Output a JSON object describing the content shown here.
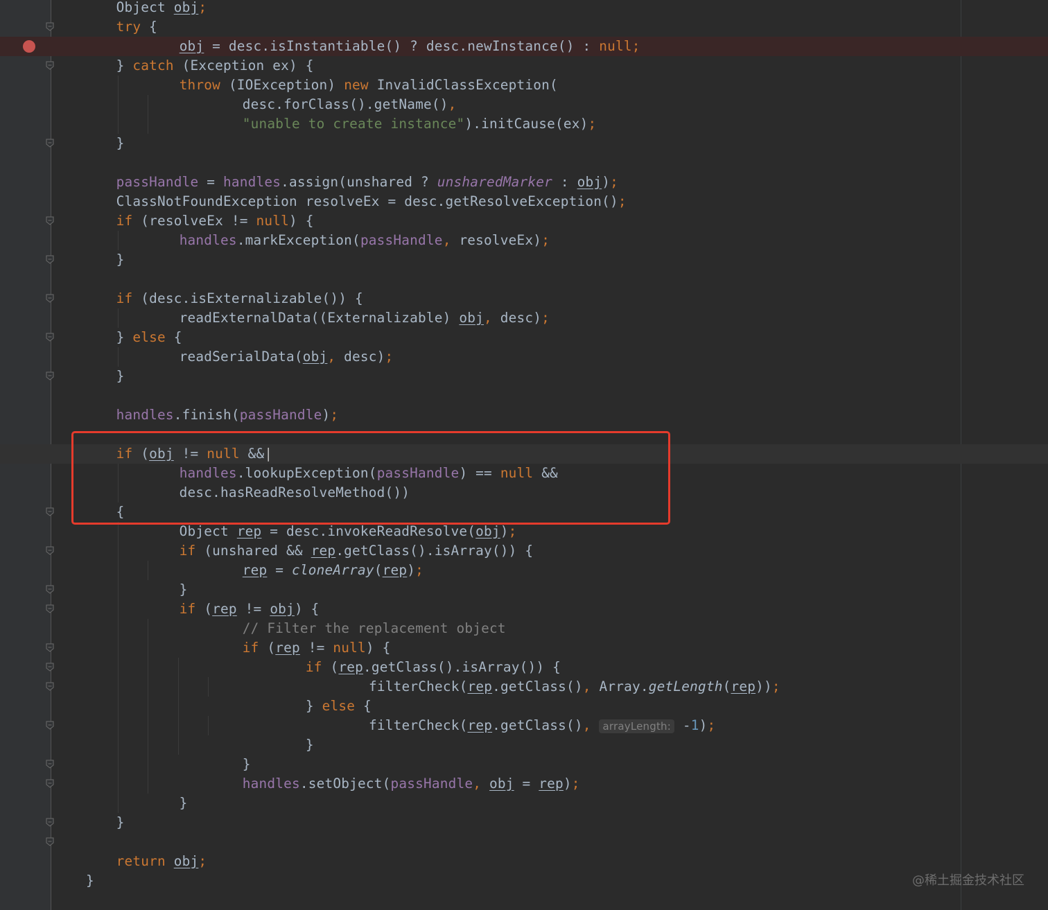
{
  "editor": {
    "breakpoint_line": 2,
    "caret_line": 23,
    "folds": [
      1,
      3,
      7,
      11,
      13,
      15,
      17,
      19,
      26,
      28,
      30,
      31,
      33,
      34,
      35,
      37,
      39,
      40,
      42,
      43,
      46
    ],
    "lines": [
      [
        [
          "Object ",
          ""
        ],
        [
          "obj",
          "v"
        ],
        [
          ";",
          "k"
        ]
      ],
      [
        [
          "try ",
          "k"
        ],
        [
          "{",
          ""
        ]
      ],
      [
        [
          "    ",
          ""
        ],
        [
          "obj",
          "v"
        ],
        [
          " = desc.isInstantiable() ? desc.newInstance() : ",
          ""
        ],
        [
          "null",
          "k"
        ],
        [
          ";",
          "k"
        ]
      ],
      [
        [
          "} ",
          ""
        ],
        [
          "catch ",
          "k"
        ],
        [
          "(Exception ex) {",
          ""
        ]
      ],
      [
        [
          "    ",
          ""
        ],
        [
          "throw ",
          "k"
        ],
        [
          "(IOException) ",
          ""
        ],
        [
          "new ",
          "k"
        ],
        [
          "InvalidClassException(",
          ""
        ]
      ],
      [
        [
          "        desc.forClass().getName()",
          ""
        ],
        [
          ",",
          "k"
        ]
      ],
      [
        [
          "        ",
          ""
        ],
        [
          "\"unable to create instance\"",
          "s"
        ],
        [
          ").initCause(ex)",
          ""
        ],
        [
          ";",
          "k"
        ]
      ],
      [
        [
          "}",
          ""
        ]
      ],
      [],
      [
        [
          "passHandle",
          "f"
        ],
        [
          " = ",
          ""
        ],
        [
          "handles",
          "f"
        ],
        [
          ".assign(unshared ? ",
          ""
        ],
        [
          "unsharedMarker",
          "sf"
        ],
        [
          " : ",
          ""
        ],
        [
          "obj",
          "v"
        ],
        [
          ")",
          ""
        ],
        [
          ";",
          "k"
        ]
      ],
      [
        [
          "ClassNotFoundException resolveEx = desc.getResolveException()",
          ""
        ],
        [
          ";",
          "k"
        ]
      ],
      [
        [
          "if ",
          "k"
        ],
        [
          "(resolveEx != ",
          ""
        ],
        [
          "null",
          "k"
        ],
        [
          ") {",
          ""
        ]
      ],
      [
        [
          "    ",
          ""
        ],
        [
          "handles",
          "f"
        ],
        [
          ".markException(",
          ""
        ],
        [
          "passHandle",
          "f"
        ],
        [
          ", ",
          "k"
        ],
        [
          "resolveEx)",
          ""
        ],
        [
          ";",
          "k"
        ]
      ],
      [
        [
          "}",
          ""
        ]
      ],
      [],
      [
        [
          "if ",
          "k"
        ],
        [
          "(desc.isExternalizable()) {",
          ""
        ]
      ],
      [
        [
          "    readExternalData((Externalizable) ",
          ""
        ],
        [
          "obj",
          "v"
        ],
        [
          ", ",
          "k"
        ],
        [
          "desc)",
          ""
        ],
        [
          ";",
          "k"
        ]
      ],
      [
        [
          "} ",
          ""
        ],
        [
          "else ",
          "k"
        ],
        [
          "{",
          ""
        ]
      ],
      [
        [
          "    readSerialData(",
          ""
        ],
        [
          "obj",
          "v"
        ],
        [
          ", ",
          "k"
        ],
        [
          "desc)",
          ""
        ],
        [
          ";",
          "k"
        ]
      ],
      [
        [
          "}",
          ""
        ]
      ],
      [],
      [
        [
          "handles",
          "f"
        ],
        [
          ".finish(",
          ""
        ],
        [
          "passHandle",
          "f"
        ],
        [
          ")",
          ""
        ],
        [
          ";",
          "k"
        ]
      ],
      [],
      [
        [
          "if ",
          "k"
        ],
        [
          "(",
          ""
        ],
        [
          "obj",
          "v"
        ],
        [
          " != ",
          ""
        ],
        [
          "null ",
          "k"
        ],
        [
          "&&",
          ""
        ],
        [
          "|",
          "c"
        ]
      ],
      [
        [
          "    ",
          ""
        ],
        [
          "handles",
          "f"
        ],
        [
          ".lookupException(",
          ""
        ],
        [
          "passHandle",
          "f"
        ],
        [
          ") == ",
          ""
        ],
        [
          "null ",
          "k"
        ],
        [
          "&&",
          ""
        ]
      ],
      [
        [
          "    desc.hasReadResolveMethod())",
          ""
        ]
      ],
      [
        [
          "{",
          ""
        ]
      ],
      [
        [
          "    Object ",
          ""
        ],
        [
          "rep",
          "v"
        ],
        [
          " = desc.invokeReadResolve(",
          ""
        ],
        [
          "obj",
          "v"
        ],
        [
          ")",
          ""
        ],
        [
          ";",
          "k"
        ]
      ],
      [
        [
          "    ",
          ""
        ],
        [
          "if ",
          "k"
        ],
        [
          "(unshared && ",
          ""
        ],
        [
          "rep",
          "v"
        ],
        [
          ".getClass().isArray()) {",
          ""
        ]
      ],
      [
        [
          "        ",
          ""
        ],
        [
          "rep",
          "v"
        ],
        [
          " = ",
          ""
        ],
        [
          "cloneArray",
          "mi"
        ],
        [
          "(",
          ""
        ],
        [
          "rep",
          "v"
        ],
        [
          ")",
          ""
        ],
        [
          ";",
          "k"
        ]
      ],
      [
        [
          "    }",
          ""
        ]
      ],
      [
        [
          "    ",
          ""
        ],
        [
          "if ",
          "k"
        ],
        [
          "(",
          ""
        ],
        [
          "rep",
          "v"
        ],
        [
          " != ",
          ""
        ],
        [
          "obj",
          "v"
        ],
        [
          ") {",
          ""
        ]
      ],
      [
        [
          "        ",
          ""
        ],
        [
          "// Filter the replacement object",
          "cm"
        ]
      ],
      [
        [
          "        ",
          ""
        ],
        [
          "if ",
          "k"
        ],
        [
          "(",
          ""
        ],
        [
          "rep",
          "v"
        ],
        [
          " != ",
          ""
        ],
        [
          "null",
          "k"
        ],
        [
          ") {",
          ""
        ]
      ],
      [
        [
          "            ",
          ""
        ],
        [
          "if ",
          "k"
        ],
        [
          "(",
          ""
        ],
        [
          "rep",
          "v"
        ],
        [
          ".getClass().isArray()) {",
          ""
        ]
      ],
      [
        [
          "                filterCheck(",
          ""
        ],
        [
          "rep",
          "v"
        ],
        [
          ".getClass()",
          ""
        ],
        [
          ", ",
          "k"
        ],
        [
          "Array.",
          ""
        ],
        [
          "getLength",
          "mi"
        ],
        [
          "(",
          ""
        ],
        [
          "rep",
          "v"
        ],
        [
          "))",
          ""
        ],
        [
          ";",
          "k"
        ]
      ],
      [
        [
          "            } ",
          ""
        ],
        [
          "else ",
          "k"
        ],
        [
          "{",
          ""
        ]
      ],
      [
        [
          "                filterCheck(",
          ""
        ],
        [
          "rep",
          "v"
        ],
        [
          ".getClass()",
          ""
        ],
        [
          ", ",
          "k"
        ],
        [
          "arrayLength:",
          "h"
        ],
        [
          " -",
          ""
        ],
        [
          "1",
          "n"
        ],
        [
          ")",
          ""
        ],
        [
          ";",
          "k"
        ]
      ],
      [
        [
          "            }",
          ""
        ]
      ],
      [
        [
          "        }",
          ""
        ]
      ],
      [
        [
          "        ",
          ""
        ],
        [
          "handles",
          "f"
        ],
        [
          ".setObject(",
          ""
        ],
        [
          "passHandle",
          "f"
        ],
        [
          ", ",
          "k"
        ],
        [
          "obj",
          "v"
        ],
        [
          " = ",
          ""
        ],
        [
          "rep",
          "v"
        ],
        [
          ")",
          ""
        ],
        [
          ";",
          "k"
        ]
      ],
      [
        [
          "    }",
          ""
        ]
      ],
      [
        [
          "}",
          ""
        ]
      ],
      [],
      [
        [
          "return ",
          "k"
        ],
        [
          "obj",
          "v"
        ],
        [
          ";",
          "k"
        ]
      ],
      [
        [
          "}",
          ""
        ]
      ]
    ],
    "indents": [
      1,
      1,
      2,
      1,
      2,
      3,
      3,
      1,
      0,
      1,
      1,
      1,
      2,
      1,
      0,
      1,
      2,
      1,
      2,
      1,
      0,
      1,
      0,
      1,
      2,
      2,
      1,
      2,
      2,
      3,
      2,
      2,
      3,
      3,
      4,
      5,
      4,
      5,
      4,
      3,
      3,
      2,
      1,
      0,
      1,
      0
    ]
  },
  "watermark": "@稀土掘金技术社区"
}
